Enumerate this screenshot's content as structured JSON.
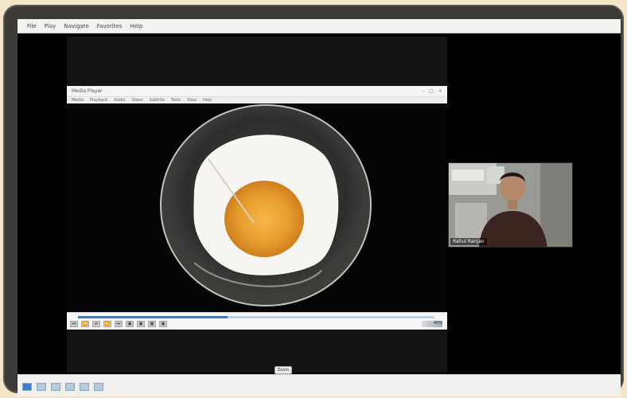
{
  "host_menubar": {
    "items": [
      "File",
      "Play",
      "Navigate",
      "Favorites",
      "Help"
    ]
  },
  "player": {
    "window_title": "Media Player",
    "titlebar_controls": [
      "–",
      "□",
      "×"
    ],
    "menu_items": [
      "Media",
      "Playback",
      "Audio",
      "Video",
      "Subtitle",
      "Tools",
      "View",
      "Help"
    ],
    "seek_progress": 0.42,
    "buttons": [
      "⏮",
      "⏪",
      "⏯",
      "⏩",
      "⏭",
      "▣",
      "▣",
      "▣",
      "▣"
    ],
    "volume": "40%"
  },
  "participant": {
    "name": "Rahul Ranjan"
  },
  "zoom_chip": "Zoom",
  "taskbar": {
    "tray_text": ""
  },
  "colors": {
    "accent": "#2f7fd0",
    "frame": "#3c3a36",
    "background": "#f3e5c8"
  }
}
